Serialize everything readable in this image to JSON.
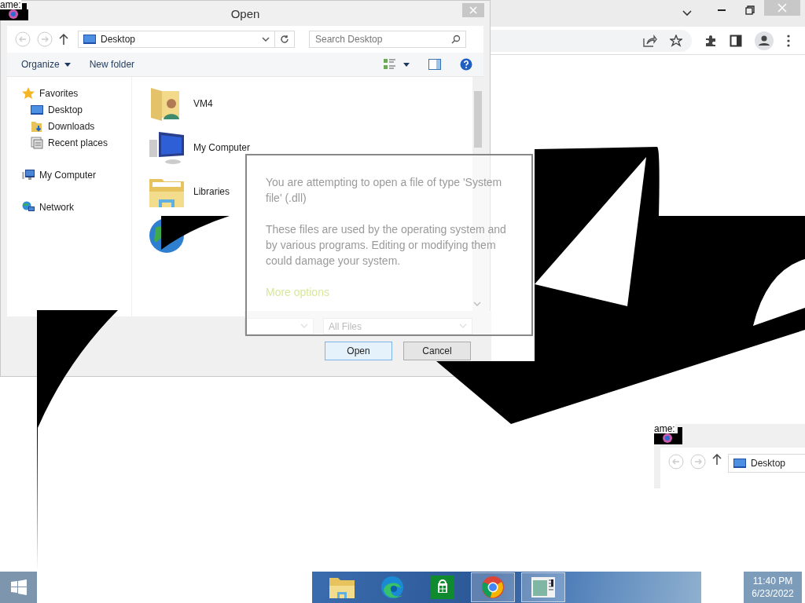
{
  "corner_label": "ame:",
  "browser": {
    "controls": [
      {
        "kind": "tabs-menu"
      },
      {
        "kind": "minimize"
      },
      {
        "kind": "restore"
      },
      {
        "kind": "close"
      }
    ],
    "toolbar": [
      {
        "kind": "share"
      },
      {
        "kind": "star"
      },
      {
        "kind": "extensions"
      },
      {
        "kind": "side-panel"
      },
      {
        "kind": "profile"
      },
      {
        "kind": "menu"
      }
    ]
  },
  "dialog": {
    "title": "Open",
    "location": "Desktop",
    "search_placeholder": "Search Desktop",
    "commands": [
      "Organize",
      "New folder"
    ],
    "nav": [
      {
        "label": "Favorites",
        "kind": "favorites",
        "children": [
          {
            "label": "Desktop",
            "kind": "desktop"
          },
          {
            "label": "Downloads",
            "kind": "downloads"
          },
          {
            "label": "Recent places",
            "kind": "recent"
          }
        ]
      },
      {
        "label": "My Computer",
        "kind": "computer"
      },
      {
        "label": "Network",
        "kind": "network"
      }
    ],
    "items": [
      {
        "label": "VM4",
        "kind": "user-folder"
      },
      {
        "label": "My Computer",
        "kind": "computer"
      },
      {
        "label": "Libraries",
        "kind": "libraries"
      },
      {
        "kind": "globe"
      }
    ],
    "file_type": "All Files",
    "buttons": [
      "Open",
      "Cancel"
    ]
  },
  "warning": {
    "message": "You are attempting to open a file of type 'System file' (.dll)",
    "detail": "These files are used by the operating system and by various programs. Editing or modifying them could damage your system.",
    "link": "More options"
  },
  "mini_window": {
    "label": "ame:",
    "location": "Desktop"
  },
  "taskbar": {
    "apps": [
      {
        "kind": "explorer",
        "selected": false
      },
      {
        "kind": "edge",
        "selected": false
      },
      {
        "kind": "store",
        "selected": false
      },
      {
        "kind": "chrome",
        "selected": true
      },
      {
        "kind": "window",
        "selected": true
      }
    ],
    "time": "11:40 PM",
    "date": "6/23/2022"
  }
}
